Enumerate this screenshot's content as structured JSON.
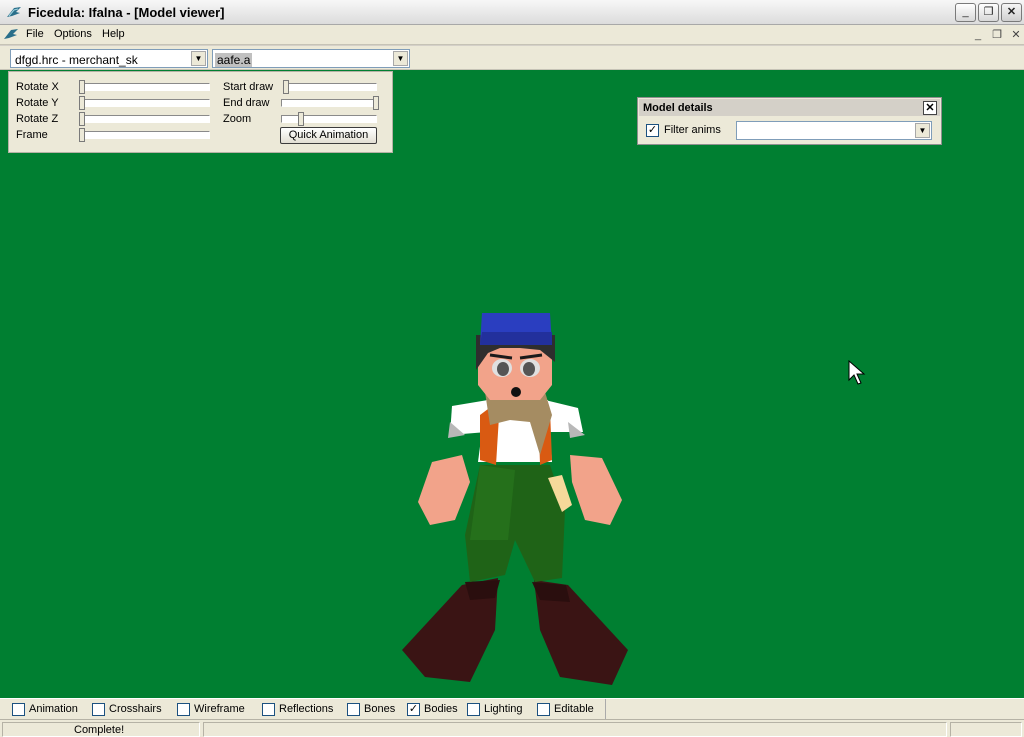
{
  "window": {
    "title": "Ficedula: Ifalna - [Model viewer]"
  },
  "menu": {
    "items": [
      "File",
      "Options",
      "Help"
    ]
  },
  "model_combo": {
    "value": "dfgd.hrc - merchant_sk"
  },
  "anim_combo": {
    "value": "aafe.a"
  },
  "controls": {
    "rotate_x": "Rotate X",
    "rotate_y": "Rotate Y",
    "rotate_z": "Rotate Z",
    "frame": "Frame",
    "start_draw": "Start draw",
    "end_draw": "End draw",
    "zoom": "Zoom",
    "quick_animation": "Quick Animation"
  },
  "model_details": {
    "title": "Model details",
    "filter_anims_label": "Filter anims",
    "filter_anims_checked": true,
    "anim_dropdown_value": ""
  },
  "options": [
    {
      "label": "Animation",
      "checked": false
    },
    {
      "label": "Crosshairs",
      "checked": false
    },
    {
      "label": "Wireframe",
      "checked": false
    },
    {
      "label": "Reflections",
      "checked": false
    },
    {
      "label": "Bones",
      "checked": false
    },
    {
      "label": "Bodies",
      "checked": true
    },
    {
      "label": "Lighting",
      "checked": false
    },
    {
      "label": "Editable",
      "checked": false
    }
  ],
  "status": {
    "text": "Complete!"
  },
  "colors": {
    "viewport_bg": "#007f31"
  },
  "icons": {
    "app": "bird-icon",
    "cursor": "mouse-cursor-icon"
  }
}
